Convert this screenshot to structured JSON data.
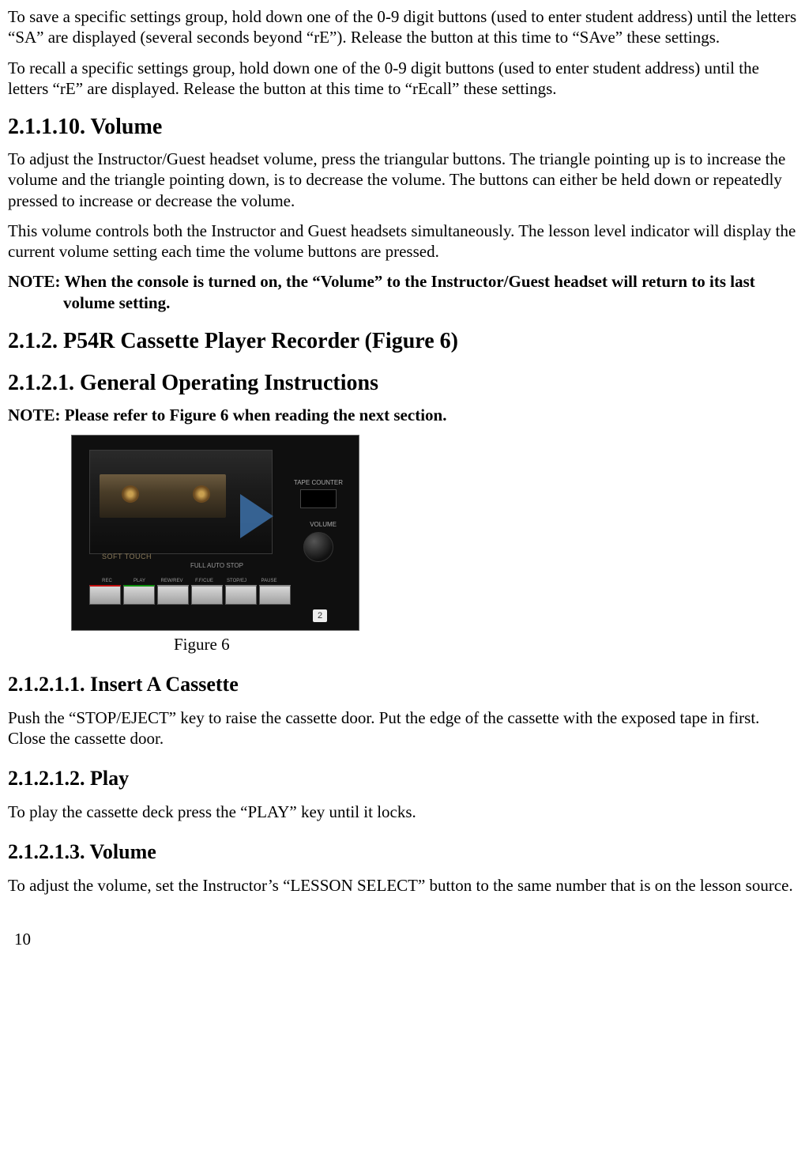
{
  "intro": {
    "p1": "To save a specific settings group, hold down one of the 0-9 digit buttons (used to enter student address) until the letters “SA” are displayed (several seconds beyond “rE”).  Release the button at this time to “SAve” these settings.",
    "p2": "To recall a specific settings group, hold down one of the 0-9 digit buttons (used to enter student address) until the letters “rE” are displayed.  Release the button at this time to “rEcall” these settings."
  },
  "s_2_1_1_10": {
    "title": "2.1.1.10.  Volume",
    "p1": "To adjust the Instructor/Guest headset volume, press the triangular buttons. The triangle pointing up is to increase the volume and the triangle pointing down, is to decrease the volume. The buttons can either be held down or repeatedly pressed to increase or decrease the volume.",
    "p2": "This volume controls both the Instructor and Guest headsets simultaneously. The lesson level indicator will display the current volume setting each time the volume buttons are pressed.",
    "note": "NOTE: When the console is turned on, the “Volume” to the Instructor/Guest headset will return to its last volume setting."
  },
  "s_2_1_2": {
    "title": "2.1.2. P54R Cassette Player Recorder (Figure 6)"
  },
  "s_2_1_2_1": {
    "title": "2.1.2.1. General Operating Instructions",
    "note": "NOTE: Please refer to Figure 6 when reading the next section."
  },
  "figure6": {
    "caption": "Figure 6",
    "labels": {
      "soft_touch": "SOFT TOUCH",
      "full_auto": "FULL AUTO STOP",
      "tape_counter": "TAPE COUNTER",
      "volume": "VOLUME",
      "badge": "2",
      "buttons": [
        "REC",
        "PLAY",
        "REW/REV",
        "F.F/CUE",
        "STOP/EJ",
        "PAUSE"
      ]
    }
  },
  "s_2_1_2_1_1": {
    "title": "2.1.2.1.1.  Insert A Cassette",
    "p1": "Push the “STOP/EJECT” key to raise the cassette door. Put the edge of the cassette with the exposed tape in first. Close the cassette door."
  },
  "s_2_1_2_1_2": {
    "title": "2.1.2.1.2.  Play",
    "p1": "To play the cassette deck press the “PLAY” key until it locks."
  },
  "s_2_1_2_1_3": {
    "title": "2.1.2.1.3.  Volume",
    "p1": "To adjust the volume, set the Instructor’s “LESSON SELECT” button to the same number that is on the lesson source."
  },
  "page_number": "10"
}
